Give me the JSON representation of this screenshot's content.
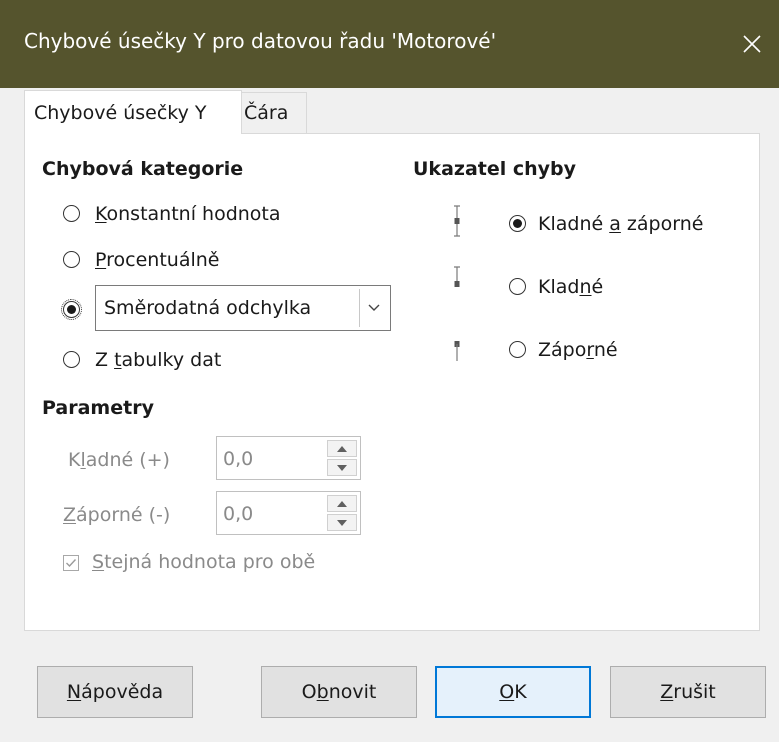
{
  "dialog": {
    "title": "Chybové úsečky Y pro datovou řadu 'Motorové'",
    "close_icon": "close-icon"
  },
  "tabs": [
    {
      "label": "Chybové úsečky Y",
      "active": true
    },
    {
      "label": "Čára",
      "active": false
    }
  ],
  "category": {
    "heading": "Chybová kategorie",
    "options": [
      {
        "prefix": "",
        "accel": "K",
        "rest": "onstantní hodnota",
        "checked": false
      },
      {
        "prefix": "",
        "accel": "P",
        "rest": "rocentuálně",
        "checked": false
      },
      {
        "selected_value": "Směrodatná odchylka",
        "checked": true
      },
      {
        "prefix": "Z ",
        "accel": "t",
        "rest": "abulky dat",
        "checked": false
      }
    ]
  },
  "params": {
    "heading": "Parametry",
    "positive": {
      "prefix": "K",
      "accel": "l",
      "rest": "adné (+)",
      "value": "0,0"
    },
    "negative": {
      "prefix": "",
      "accel": "Z",
      "rest": "áporné (-)",
      "value": "0,0"
    },
    "same_value": {
      "accel": "S",
      "rest": "tejná hodnota pro obě",
      "checked": true
    }
  },
  "indicator": {
    "heading": "Ukazatel chyby",
    "options": [
      {
        "prefix": "Kladné ",
        "accel": "a",
        "rest": " záporné",
        "checked": true,
        "icon": "error-bar-both-icon"
      },
      {
        "prefix": "Klad",
        "accel": "n",
        "rest": "é",
        "checked": false,
        "icon": "error-bar-positive-icon"
      },
      {
        "prefix": "Zápo",
        "accel": "r",
        "rest": "né",
        "checked": false,
        "icon": "error-bar-negative-icon"
      }
    ]
  },
  "buttons": {
    "help": {
      "accel": "N",
      "rest": "ápověda"
    },
    "reset": {
      "prefix": "O",
      "accel": "b",
      "rest": "novit"
    },
    "ok": {
      "accel": "O",
      "rest": "K"
    },
    "cancel": {
      "accel": "Z",
      "rest": "rušit"
    }
  },
  "colors": {
    "titlebar": "#55542d",
    "focus": "#0078d7"
  }
}
